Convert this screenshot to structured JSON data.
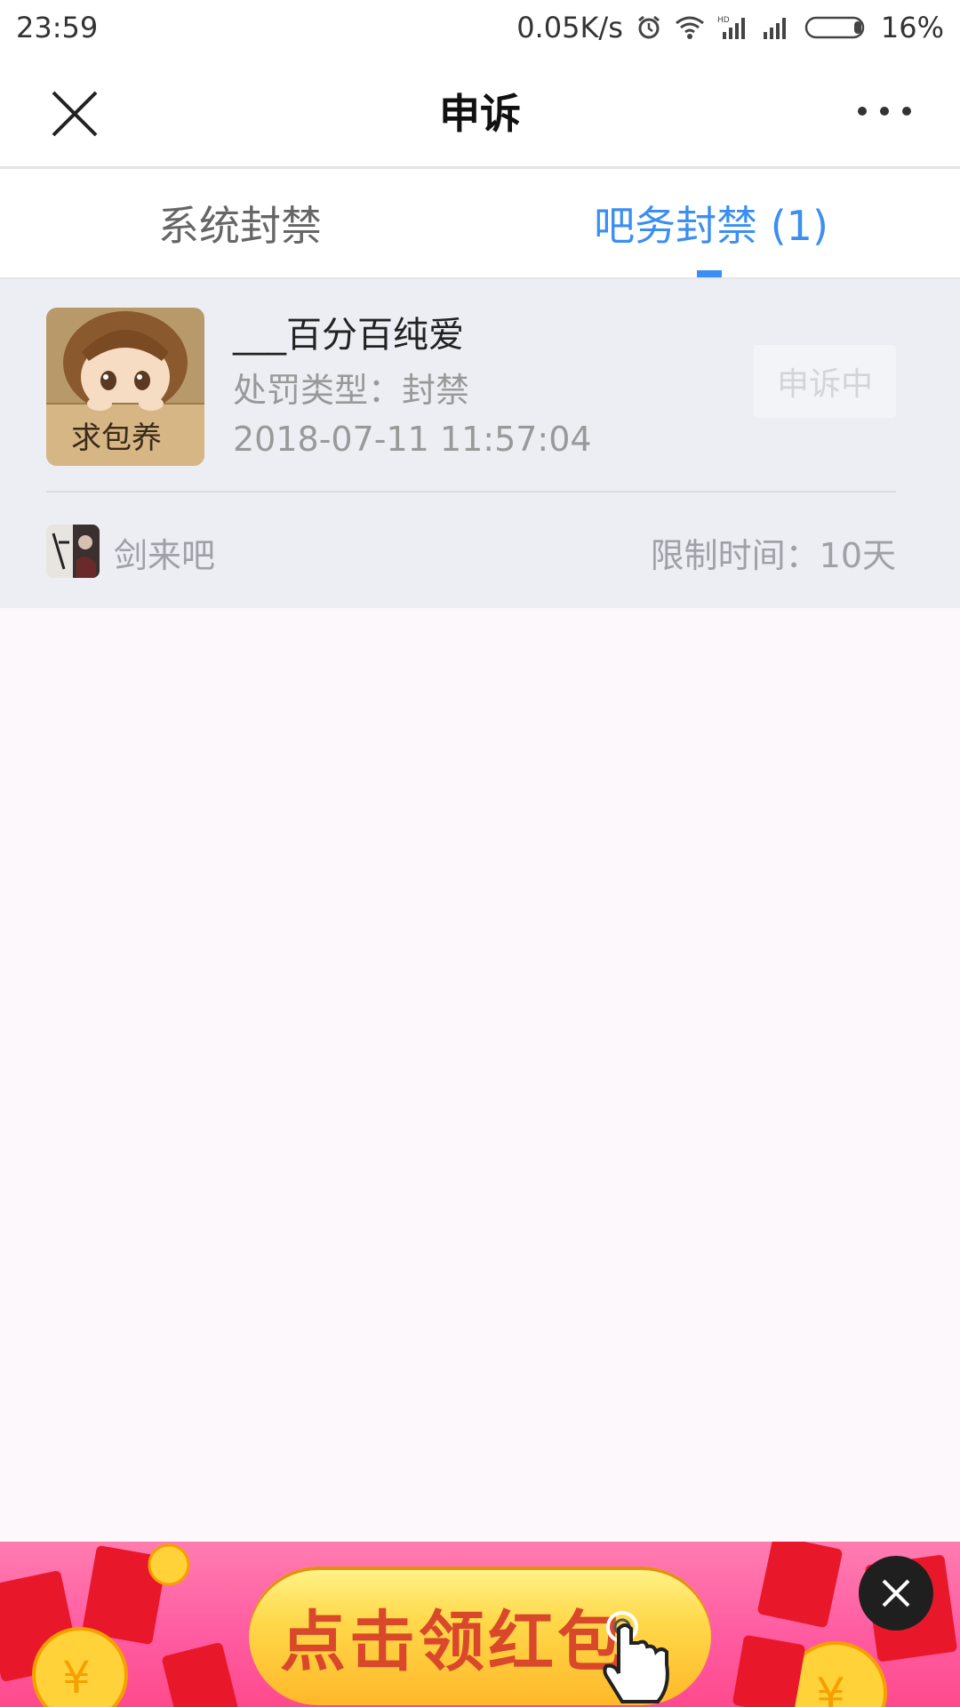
{
  "status_bar": {
    "time": "23:59",
    "network_speed": "0.05K/s",
    "battery": "16%",
    "icons": [
      "alarm-icon",
      "wifi-icon",
      "hd-signal-icon",
      "signal-icon",
      "battery-icon"
    ]
  },
  "nav": {
    "title": "申诉",
    "close_icon": "close-icon",
    "more_icon": "more-icon"
  },
  "tabs": [
    {
      "label": "系统封禁",
      "active": false
    },
    {
      "label": "吧务封禁 (1)",
      "active": true
    }
  ],
  "ban_record": {
    "username": "___百分百纯爱",
    "punish_type": "处罚类型：封禁",
    "time": "2018-07-11 11:57:04",
    "appeal_status": "申诉中",
    "forum_name": "剑来吧",
    "limit_time": "限制时间：10天",
    "avatar_text": "求包养"
  },
  "banner": {
    "text": "点击领红包"
  },
  "colors": {
    "accent": "#3b8ff0",
    "card_bg": "#eceef4",
    "banner_pink": "#ff5aa0"
  }
}
